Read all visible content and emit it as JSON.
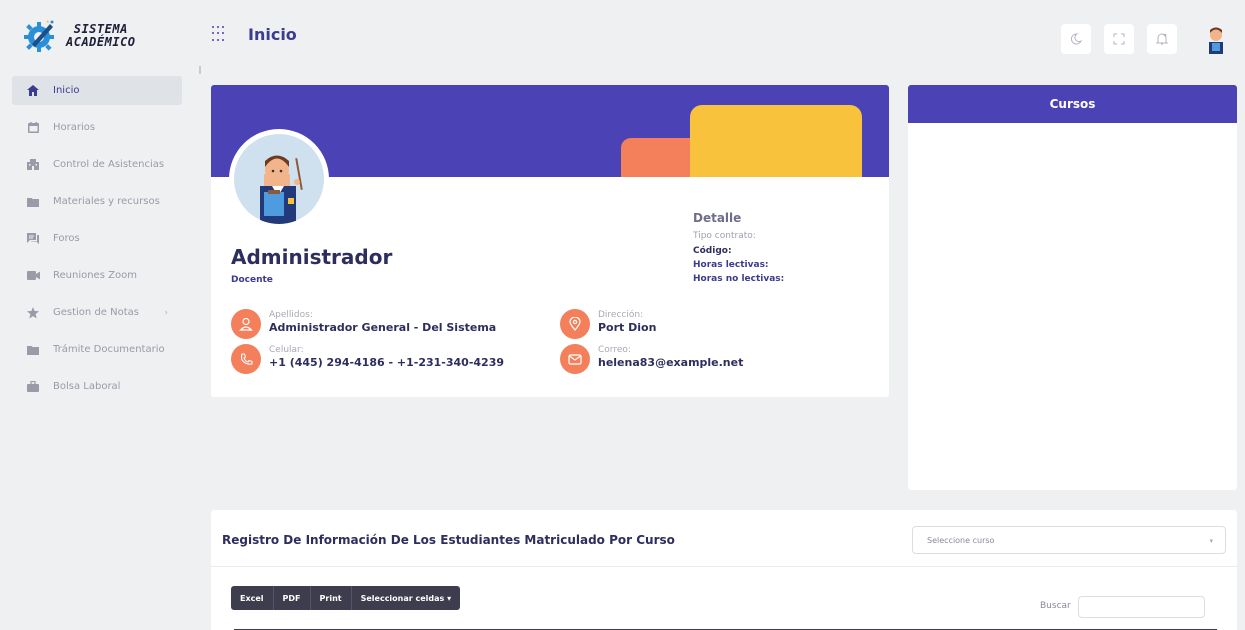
{
  "brand": {
    "line1": "SISTEMA",
    "line2": "ACADÉMICO"
  },
  "header": {
    "title": "Inicio"
  },
  "sidebar": {
    "items": [
      {
        "label": "Inicio",
        "icon": "home-icon"
      },
      {
        "label": "Horarios",
        "icon": "calendar-icon"
      },
      {
        "label": "Control de Asistencias",
        "icon": "building-icon"
      },
      {
        "label": "Materiales y recursos",
        "icon": "folder-icon"
      },
      {
        "label": "Foros",
        "icon": "forum-icon"
      },
      {
        "label": "Reuniones Zoom",
        "icon": "video-icon"
      },
      {
        "label": "Gestion de Notas",
        "icon": "star-icon",
        "chevron": "›"
      },
      {
        "label": "Trámite Documentario",
        "icon": "folder-icon"
      },
      {
        "label": "Bolsa Laboral",
        "icon": "briefcase-icon"
      }
    ]
  },
  "profile": {
    "name": "Administrador",
    "role": "Docente",
    "detail": {
      "title": "Detalle",
      "contract_label": "Tipo contrato:",
      "code_label": "Código:",
      "hours_label": "Horas lectivas:",
      "non_hours_label": "Horas no lectivas:"
    },
    "apellidos_label": "Apellidos:",
    "apellidos_value": "Administrador General - Del Sistema",
    "direccion_label": "Dirección:",
    "direccion_value": "Port Dion",
    "celular_label": "Celular:",
    "celular_value": "+1 (445) 294-4186 - +1-231-340-4239",
    "correo_label": "Correo:",
    "correo_value": "helena83@example.net"
  },
  "courses": {
    "title": "Cursos"
  },
  "register": {
    "title": "Registro De Información De Los Estudiantes Matriculado Por Curso",
    "select_placeholder": "Seleccione curso",
    "buttons": {
      "excel": "Excel",
      "pdf": "PDF",
      "print": "Print",
      "select_cells": "Seleccionar celdas ▾"
    },
    "search_label": "Buscar"
  },
  "colors": {
    "primary": "#4a42b5",
    "accent_orange": "#f47f5b",
    "accent_yellow": "#f9c23c"
  }
}
